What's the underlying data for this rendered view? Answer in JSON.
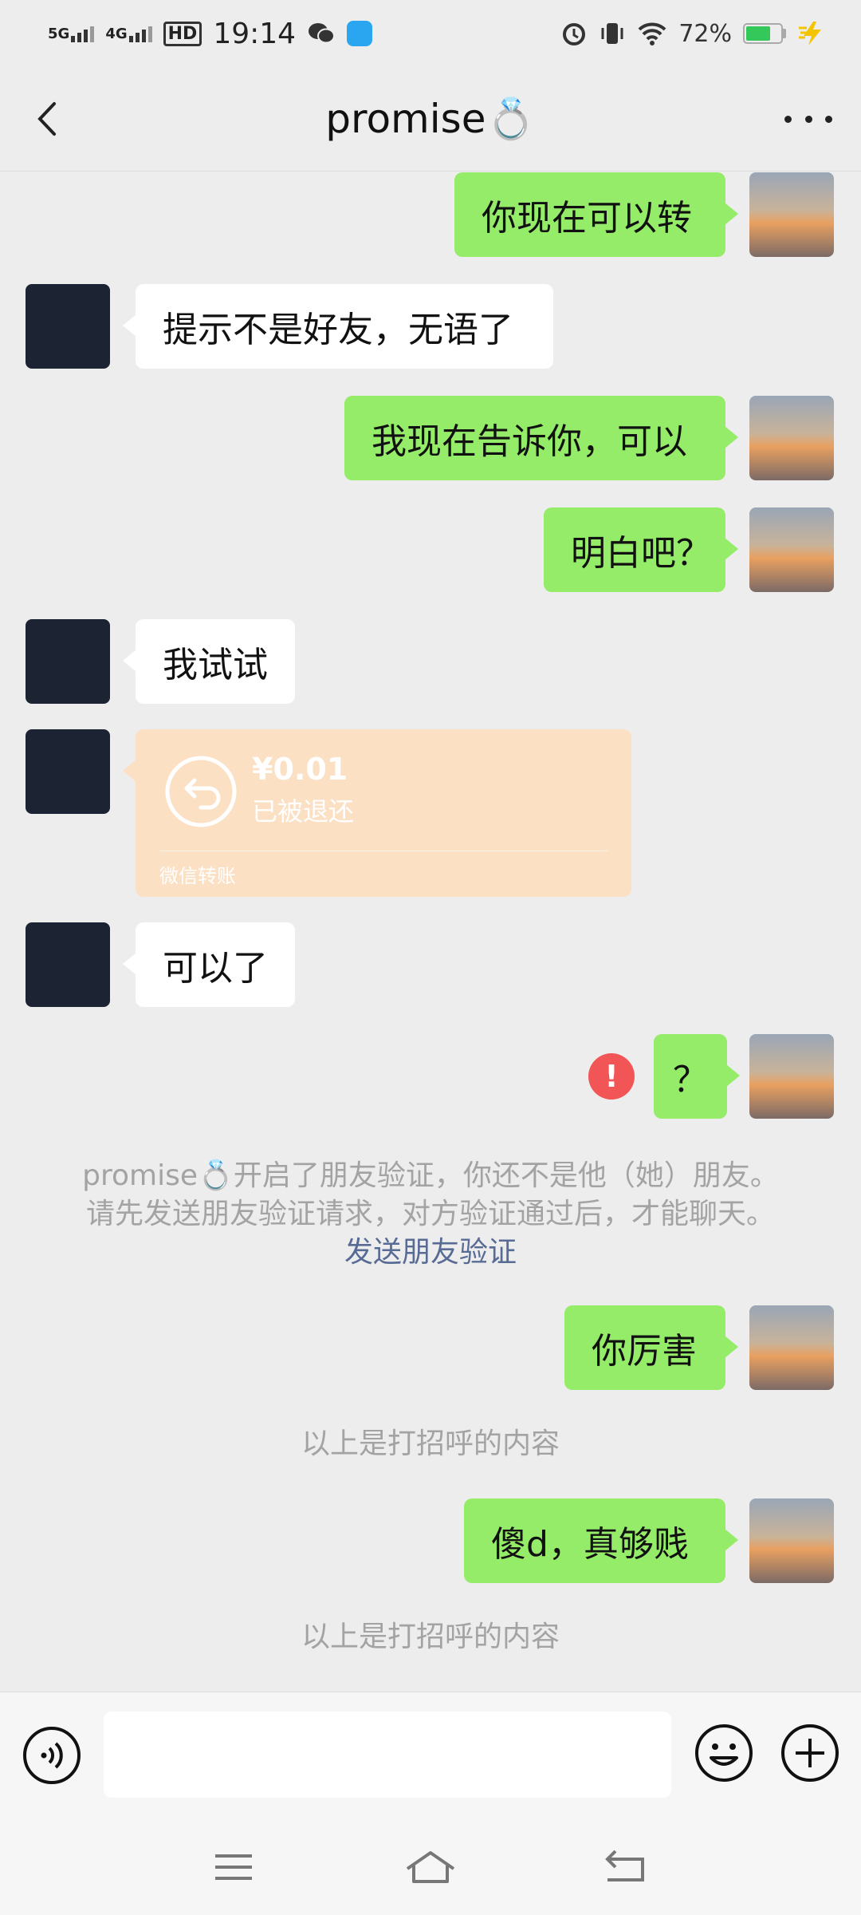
{
  "status_bar": {
    "signal_1": "5G",
    "signal_2": "4G",
    "hd": "HD",
    "time": "19:14",
    "battery_percent": "72%",
    "battery_level": 0.72
  },
  "header": {
    "title": "promise💍",
    "back_icon": "chevron-left-icon",
    "more_icon": "more-dots-icon"
  },
  "messages": [
    {
      "from": "me",
      "text": "你现在可以转"
    },
    {
      "from": "them",
      "text": "提示不是好友，无语了"
    },
    {
      "from": "me",
      "text": "我现在告诉你，可以"
    },
    {
      "from": "me",
      "text": "明白吧？"
    },
    {
      "from": "them",
      "text": "我试试"
    },
    {
      "from": "them",
      "type": "transfer",
      "amount": "¥0.01",
      "status": "已被退还",
      "label": "微信转账"
    },
    {
      "from": "them",
      "text": "可以了"
    },
    {
      "from": "me",
      "text": "？",
      "failed": true
    },
    {
      "from": "me",
      "text": "你厉害"
    },
    {
      "from": "me",
      "text": "傻d，真够贱"
    }
  ],
  "system_notice": {
    "line1": "promise💍开启了朋友验证，你还不是他（她）朋友。",
    "line2": "请先发送朋友验证请求，对方验证通过后，才能聊天。",
    "link": "发送朋友验证"
  },
  "greeting_notice_1": "以上是打招呼的内容",
  "greeting_notice_2": "以上是打招呼的内容",
  "input_bar": {
    "value": "",
    "voice_icon": "voice-icon",
    "emoji_icon": "emoji-icon",
    "plus_icon": "plus-icon"
  },
  "colors": {
    "my_bubble": "#95ec69",
    "their_bubble": "#ffffff",
    "transfer_card": "#fbe0c4",
    "alert": "#f25555",
    "link": "#576b95"
  }
}
